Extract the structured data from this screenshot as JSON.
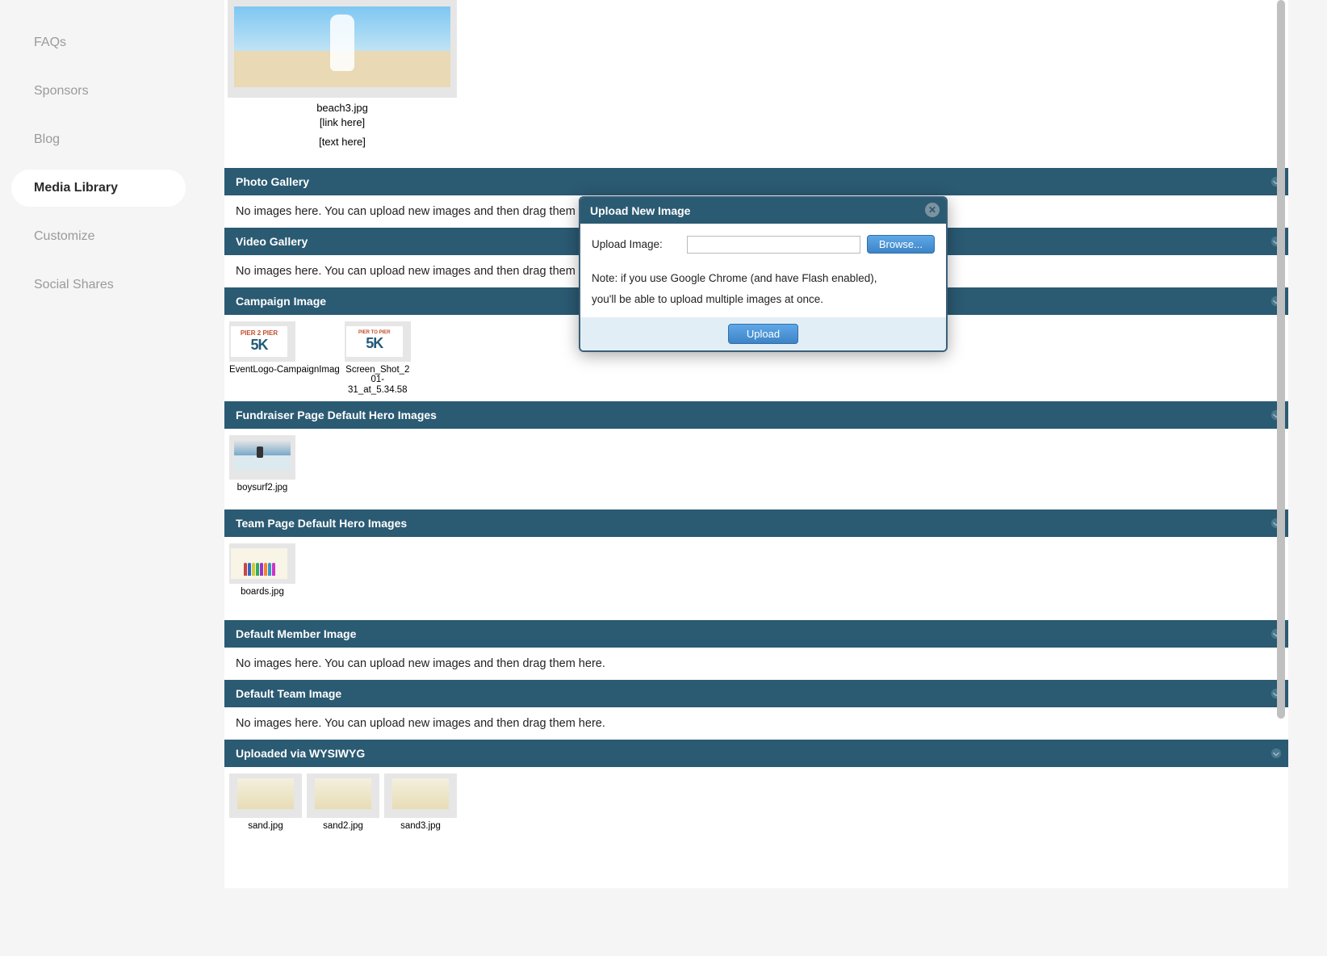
{
  "sidebar": {
    "items": [
      {
        "label": "FAQs"
      },
      {
        "label": "Sponsors"
      },
      {
        "label": "Blog"
      },
      {
        "label": "Media Library"
      },
      {
        "label": "Customize"
      },
      {
        "label": "Social Shares"
      }
    ]
  },
  "banner": {
    "filename": "beach3.jpg",
    "link_placeholder": "[link here]",
    "text_placeholder": "[text here]"
  },
  "sections": {
    "photo_gallery": {
      "title": "Photo Gallery",
      "empty": "No images here. You can upload new images and then drag them here."
    },
    "video_gallery": {
      "title": "Video Gallery",
      "empty": "No images here. You can upload new images and then drag them here."
    },
    "campaign_image": {
      "title": "Campaign Image",
      "items": [
        {
          "label": "EventLogo-CampaignImag",
          "logo_top": "PIER 2 PIER",
          "logo_main": "5K"
        },
        {
          "label": "Screen_Shot_2\n01-\n31_at_5.34.58",
          "logo_top": "PIER\nTO\nPIER",
          "logo_main": "5K"
        }
      ]
    },
    "fundraiser_hero": {
      "title": "Fundraiser Page Default Hero Images",
      "items": [
        {
          "label": "boysurf2.jpg"
        }
      ]
    },
    "team_hero": {
      "title": "Team Page Default Hero Images",
      "items": [
        {
          "label": "boards.jpg"
        }
      ]
    },
    "default_member": {
      "title": "Default Member Image",
      "empty": "No images here. You can upload new images and then drag them here."
    },
    "default_team": {
      "title": "Default Team Image",
      "empty": "No images here. You can upload new images and then drag them here."
    },
    "wysiwyg": {
      "title": "Uploaded via WYSIWYG",
      "items": [
        {
          "label": "sand.jpg"
        },
        {
          "label": "sand2.jpg"
        },
        {
          "label": "sand3.jpg"
        }
      ]
    }
  },
  "modal": {
    "title": "Upload New Image",
    "label": "Upload Image:",
    "browse": "Browse...",
    "note1": "Note: if you use Google Chrome (and have Flash enabled),",
    "note2": "you'll be able to upload multiple images at once.",
    "upload": "Upload"
  }
}
